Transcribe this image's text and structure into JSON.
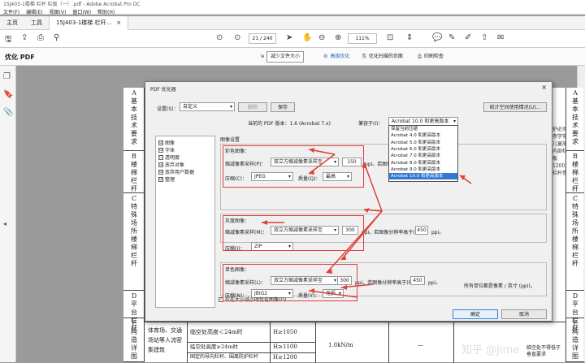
{
  "window": {
    "title": "15J403-1楼梯 栏杆 栏板（一）.pdf - Adobe Acrobat Pro DC"
  },
  "menu": [
    "文件(F)",
    "编辑(E)",
    "视图(V)",
    "窗口(W)",
    "帮助(H)"
  ],
  "tabs": {
    "home": "主页",
    "tools": "工具",
    "doc": "15J403-1楼梯 栏杆...",
    "doc_close": "×"
  },
  "toolbar": {
    "page": "21 / 240",
    "zoom": "111%"
  },
  "optimize_bar": {
    "title": "优化 PDF",
    "reduce": "减少文件大小",
    "advanced": "高级优化",
    "scan": "优化扫描的页面",
    "print": "印刷检查"
  },
  "dialog": {
    "title": "PDF 优化器",
    "close": "×",
    "settings_label": "设置(S)：",
    "settings_value": "自定义",
    "delete_btn": "删除",
    "save_btn": "保存",
    "audit_btn": "统计空间使用情况(U)...",
    "current_version": "当前的 PDF 版本：1.6 (Acrobat 7.x)",
    "compat_label": "兼容于(I)：",
    "compat_value": "Acrobat 10.0 和更高版本",
    "compat_options": [
      "保留当前压缩",
      "Acrobat 4.0 和更高版本",
      "Acrobat 5.0 和更高版本",
      "Acrobat 6.0 和更高版本",
      "Acrobat 7.0 和更高版本",
      "Acrobat 8.0 和更高版本",
      "Acrobat 9.0 和更高版本",
      "Acrobat 10.0 和更高版本"
    ],
    "categories": [
      {
        "label": "图像",
        "checked": "☑"
      },
      {
        "label": "字体",
        "checked": "☑"
      },
      {
        "label": "透明度",
        "checked": "☐"
      },
      {
        "label": "放弃对象",
        "checked": "☑"
      },
      {
        "label": "放弃用户数据",
        "checked": "☑"
      },
      {
        "label": "整理",
        "checked": "☑"
      }
    ],
    "image_settings": "图像设置",
    "color": {
      "title": "彩色图像：",
      "down_label": "缩减像素采样(P)：",
      "down_value": "双立方缩减像素采样至",
      "ppi_value": "150",
      "ppi": "ppi。若图像分辨率",
      "comp_label": "压缩(C)：",
      "comp_value": "JPEG",
      "quality_label": "质量(Q)：",
      "quality_value": "最高"
    },
    "gray": {
      "title": "灰度图像：",
      "down_label": "缩减像素采样(M)：",
      "down_value": "双立方缩减像素采样至",
      "ppi_value": "300",
      "ppi_text": "ppi。若图像分辨率高于(O)",
      "above_value": "450",
      "ppi_end": "ppi。",
      "comp_label": "压缩(I)：",
      "comp_value": "ZIP"
    },
    "mono": {
      "title": "单色图像：",
      "down_label": "缩减像素采样(L)：",
      "down_value": "双立方缩减像素采样至",
      "ppi_value": "300",
      "ppi_text": "ppi。若图像分辨率高于(R)",
      "above_value": "450",
      "ppi_end": "ppi。",
      "comp_label": "压缩(N)：",
      "comp_value": "JBIG2",
      "quality_label": "质量(Y)：",
      "quality_value": "无损"
    },
    "units_note": "所有单位都是像素 / 英寸 (ppi)。",
    "only_reduce": "仅在大小减小时优化图像(O)",
    "ok": "确定",
    "cancel": "取消"
  },
  "document": {
    "left_cells": [
      "A\n基本技术要求",
      "B\n楼梯栏杆",
      "C\n特殊场所楼梯栏杆",
      "D\n平台栏杆",
      "E\n构造详图"
    ],
    "right_cells": [
      "A\n基本技术要求",
      "B\n楼梯栏杆",
      "C\n特殊场所楼梯栏杆",
      "D\n平台栏杆",
      "E\n构造详图"
    ],
    "right_text": "护必须参学常儿童施内部栏板1200,栏杆参",
    "bottom": {
      "col1": "体育场、交通场站等人流密集建筑",
      "col2a": "临空处高度＜24m时",
      "col2b": "临空处高度≥24m时",
      "col2c": "固定的导向栏杆、围离防护栏杆",
      "col3a": "H≥1050",
      "col3b": "H≥1100",
      "col3c": "H≥1200",
      "col4": "1.0kN/m",
      "col5": "—",
      "col6": "临空处不得低于垂直要求"
    }
  },
  "watermark": "知乎 @Jime"
}
